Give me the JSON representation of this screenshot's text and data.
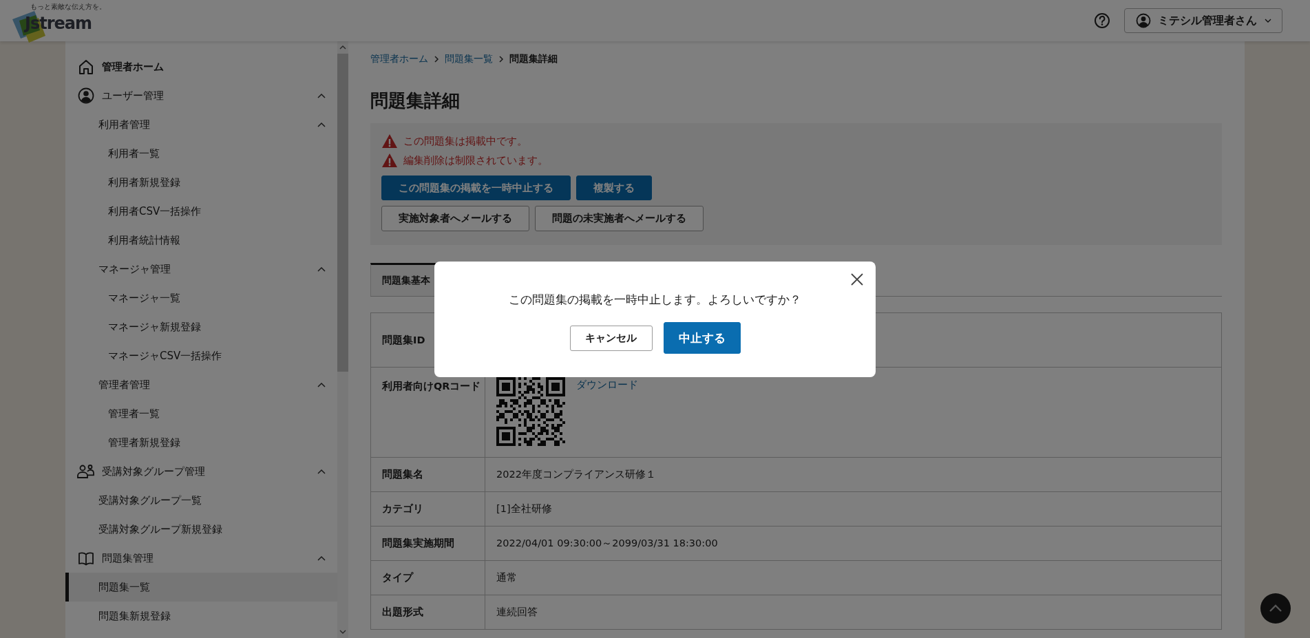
{
  "header": {
    "logo": {
      "tagline": "もっと素敵な伝え方を。",
      "wordmark": "Jstream"
    },
    "user_menu": {
      "label": "ミテシル管理者さん"
    }
  },
  "sidebar": {
    "items": [
      {
        "label": "管理者ホーム",
        "selected": false
      },
      {
        "label": "ユーザー管理",
        "selected": false,
        "expanded": true,
        "children": [
          {
            "label": "利用者管理",
            "selected": false,
            "expanded": true,
            "children": [
              {
                "label": "利用者一覧",
                "selected": false
              },
              {
                "label": "利用者新規登録",
                "selected": false
              },
              {
                "label": "利用者CSV一括操作",
                "selected": false
              },
              {
                "label": "利用者統計情報",
                "selected": false
              }
            ]
          },
          {
            "label": "マネージャ管理",
            "selected": false,
            "expanded": true,
            "children": [
              {
                "label": "マネージャ一覧",
                "selected": false
              },
              {
                "label": "マネージャ新規登録",
                "selected": false
              },
              {
                "label": "マネージャCSV一括操作",
                "selected": false
              }
            ]
          },
          {
            "label": "管理者管理",
            "selected": false,
            "expanded": true,
            "children": [
              {
                "label": "管理者一覧",
                "selected": false
              },
              {
                "label": "管理者新規登録",
                "selected": false
              }
            ]
          }
        ]
      },
      {
        "label": "受講対象グループ管理",
        "selected": false,
        "expanded": true,
        "children": [
          {
            "label": "受講対象グループ一覧",
            "selected": false
          },
          {
            "label": "受講対象グループ新規登録",
            "selected": false
          }
        ]
      },
      {
        "label": "問題集管理",
        "selected": false,
        "expanded": true,
        "children": [
          {
            "label": "問題集一覧",
            "selected": true
          },
          {
            "label": "問題集新規登録",
            "selected": false
          }
        ]
      }
    ]
  },
  "breadcrumb": [
    {
      "label": "管理者ホーム",
      "kind": "link"
    },
    {
      "label": "問題集一覧",
      "kind": "link"
    },
    {
      "label": "問題集詳細",
      "kind": "current"
    }
  ],
  "page_title": "問題集詳細",
  "notice": {
    "warnings": [
      "この問題集は掲載中です。",
      "編集削除は制限されています。"
    ],
    "button_rows": [
      [
        {
          "label": "この問題集の掲載を一時中止する",
          "kind": "primary"
        },
        {
          "label": "複製する",
          "kind": "primary"
        }
      ],
      [
        {
          "label": "実施対象者へメールする",
          "kind": "secondary"
        },
        {
          "label": "問題の未実施者へメールする",
          "kind": "secondary"
        }
      ]
    ]
  },
  "tabs": [
    {
      "label": "問題集基本",
      "selected": true
    }
  ],
  "details": {
    "rows": [
      {
        "label": "問題集ID",
        "kind": "text"
      },
      {
        "label": "利用者向けQRコード",
        "kind": "qr",
        "link": "ダウンロード"
      },
      {
        "label": "問題集名",
        "kind": "text",
        "value": "2022年度コンプライアンス研修１"
      },
      {
        "label": "カテゴリ",
        "kind": "text",
        "value": "[1]全社研修"
      },
      {
        "label": "問題集実施期間",
        "kind": "text",
        "value": "2022/04/01 09:30:00～2099/03/31 18:30:00"
      },
      {
        "label": "タイプ",
        "kind": "text",
        "value": "通常"
      },
      {
        "label": "出題形式",
        "kind": "text",
        "value": "連続回答"
      }
    ]
  },
  "dialog": {
    "message": "この問題集の掲載を一時中止します。よろしいですか？",
    "buttons": [
      {
        "label": "キャンセル",
        "kind": "secondary"
      },
      {
        "label": "中止する",
        "kind": "primary"
      }
    ]
  }
}
